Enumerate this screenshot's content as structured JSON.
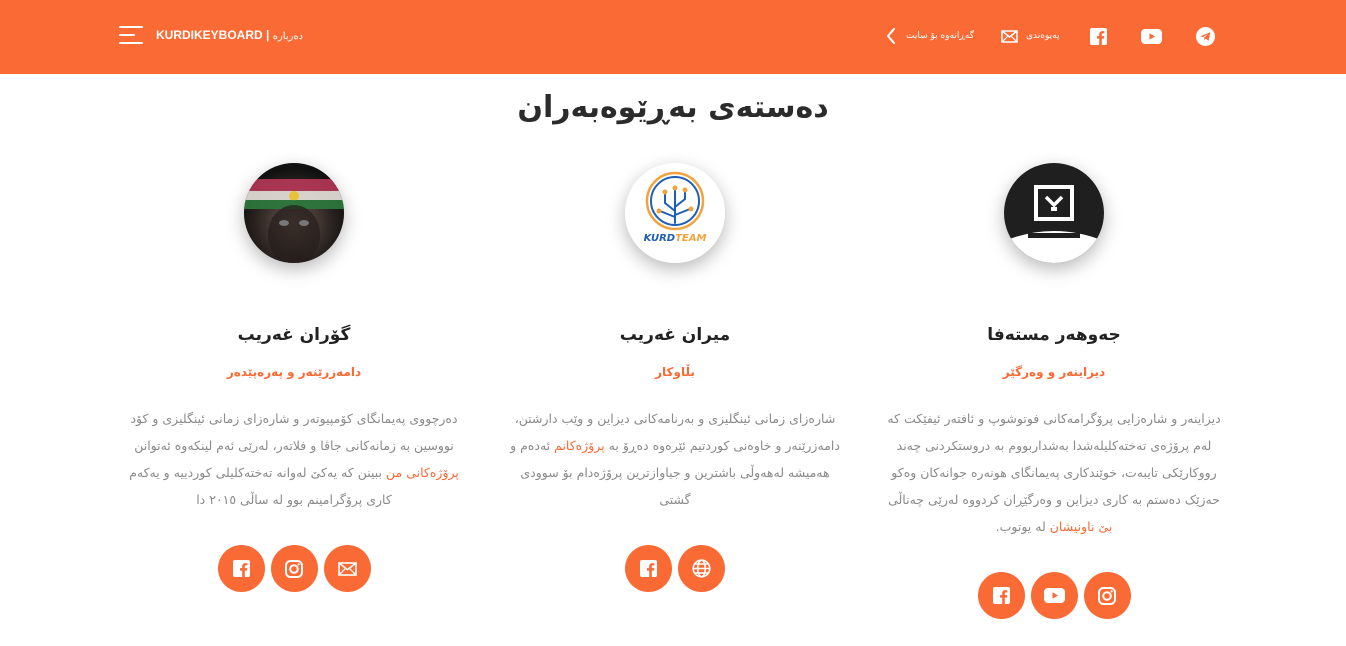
{
  "header": {
    "brand": "KURDIKEYBOARD |",
    "about": "دەربارە",
    "back_label": "گەڕانەوە بۆ سایت",
    "contact_label": "پەیوەندی",
    "colors": {
      "background": "#f96a35",
      "foreground": "#ffffff"
    },
    "social_icons": [
      "facebook-icon",
      "youtube-icon",
      "telegram-icon"
    ]
  },
  "section": {
    "title": "دەستەی بەڕێوەبەران"
  },
  "members": [
    {
      "name": "گۆران غەریب",
      "role": "دامەزرێنەر و پەرەپێدەر",
      "bio_before": "دەرچووی پەیمانگای کۆمپیوتەر و شارەزای زمانی ئینگلیزی و کۆد نووسین بە زمانەکانی جاڤا و فلاتەر، لەرێی ئەم لینکەوە ئەتوانن ",
      "bio_link": "پرۆژەکانی من",
      "bio_after": " ببینن کە یەکێ لەوانە تەختەکلیلی کوردییە و یەکەم کاری پرۆگرامینم بوو لە ساڵی ٢٠١٥ دا",
      "links": [
        "facebook-icon",
        "instagram-icon",
        "mail-icon"
      ]
    },
    {
      "name": "میران غەریب",
      "role": "بڵاوکار",
      "bio_before": "شارەزای زمانی ئینگلیزی و بەرنامەکانی دیزاین و وێب دارشتن، دامەزرێنەر و خاوەنی کوردتیم ئێرەوە دەڕۆ بە ",
      "bio_link": "پرۆژەکانم",
      "bio_after": " ئەدەم و هەمیشە لەهەوڵی باشترین و جیاوازترین پرۆژەدام بۆ سوودی گشتی",
      "links": [
        "facebook-icon",
        "globe-icon"
      ]
    },
    {
      "name": "جەوهەر مستەفا",
      "role": "دیزاینەر و وەرگێر",
      "bio_before": "دیزاینەر و شارەزایی پرۆگرامەکانی فوتوشوپ و ئافتەر ئیفێکت کە لەم پرۆژەی تەختەکلیلەشدا بەشداربووم بە دروستکردنی چەند رووکارێکی تایبەت، خوێندکاری پەیمانگای هونەرە جوانەکان وەکو حەزێک دەستم بە کاری دیزاین و وەرگێڕان کردووە لەرێی چەناڵی ",
      "bio_link": "بێ ناونیشان",
      "bio_after": " لە یوتوب.",
      "links": [
        "facebook-icon",
        "youtube-icon",
        "instagram-icon"
      ]
    }
  ],
  "accent_color": "#f96a35"
}
